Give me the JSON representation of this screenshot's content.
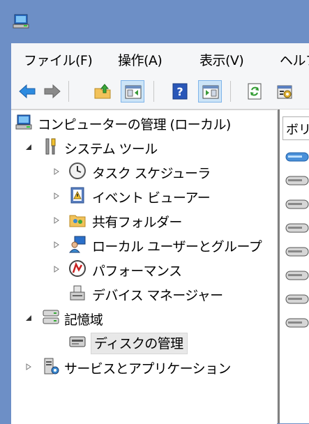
{
  "window": {
    "icon": "computer-management-icon"
  },
  "menu": [
    {
      "label": "ファイル(F)"
    },
    {
      "label": "操作(A)"
    },
    {
      "label": "表示(V)"
    },
    {
      "label": "ヘルプ(H)"
    }
  ],
  "toolbar": {
    "buttons": [
      "back-arrow-icon",
      "forward-arrow-icon",
      "up-folder-icon",
      "show-hide-console-tree-icon",
      "help-icon",
      "show-hide-action-pane-icon",
      "refresh-icon",
      "properties-icon"
    ]
  },
  "tree": {
    "root": {
      "label": "コンピューターの管理 (ローカル)"
    },
    "system_tools": {
      "label": "システム ツール"
    },
    "task_scheduler": {
      "label": "タスク スケジューラ"
    },
    "event_viewer": {
      "label": "イベント ビューアー"
    },
    "shared_folders": {
      "label": "共有フォルダー"
    },
    "local_users": {
      "label": "ローカル ユーザーとグループ"
    },
    "performance": {
      "label": "パフォーマンス"
    },
    "device_manager": {
      "label": "デバイス マネージャー"
    },
    "storage": {
      "label": "記憶域"
    },
    "disk_management": {
      "label": "ディスクの管理"
    },
    "services_apps": {
      "label": "サービスとアプリケーション"
    }
  },
  "right_pane": {
    "column_header": "ボリューム",
    "disk_rows": 8
  },
  "colors": {
    "title_bar": "#6d8fc6",
    "selection": "#cce4f7"
  }
}
